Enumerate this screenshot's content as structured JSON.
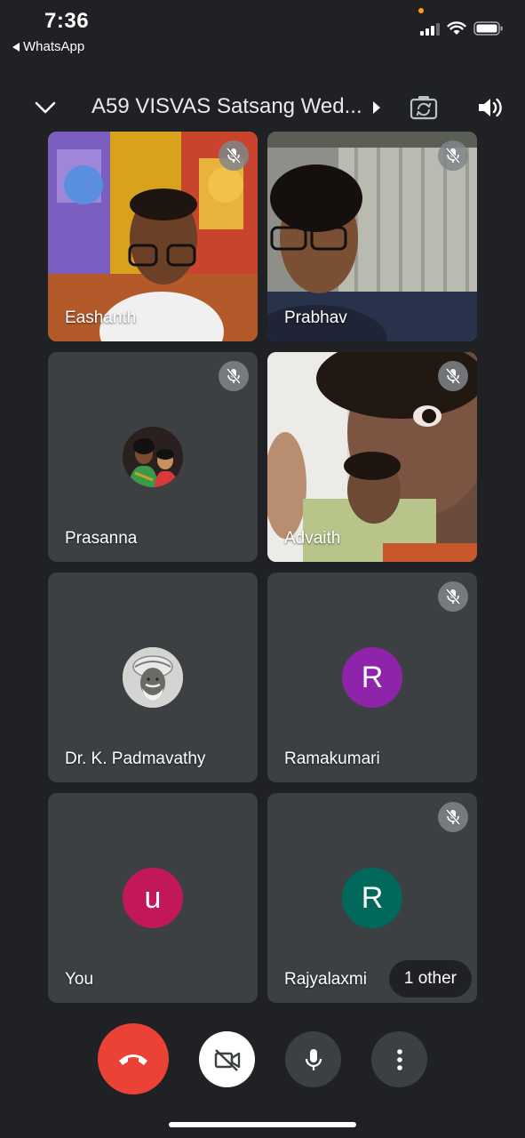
{
  "status_bar": {
    "time": "7:36",
    "back_app": "WhatsApp"
  },
  "header": {
    "meeting_title": "A59 VISVAS Satsang Wed..."
  },
  "participants": [
    {
      "name": "Eashanth",
      "muted": true,
      "video": true
    },
    {
      "name": "Prabhav",
      "muted": true,
      "video": true
    },
    {
      "name": "Prasanna",
      "muted": true,
      "video": false,
      "avatar": "photo"
    },
    {
      "name": "Advaith",
      "muted": true,
      "video": true
    },
    {
      "name": "Dr. K. Padmavathy",
      "muted": true,
      "video": false,
      "avatar": "photo"
    },
    {
      "name": "Ramakumari",
      "muted": true,
      "video": false,
      "initial": "R",
      "color": "#8e24aa"
    },
    {
      "name": "You",
      "muted": false,
      "video": false,
      "initial": "u",
      "color": "#c2185b"
    },
    {
      "name": "Rajyalaxmi",
      "muted": true,
      "video": false,
      "initial": "R",
      "color": "#00695c"
    }
  ],
  "others_chip": "1 other",
  "controls": [
    {
      "icon": "end-call-icon",
      "color": "#ea4335"
    },
    {
      "icon": "camera-off-icon",
      "color": "#ffffff"
    },
    {
      "icon": "microphone-icon",
      "color": "#3c4043"
    },
    {
      "icon": "more-vert-icon",
      "color": "#3c4043"
    }
  ]
}
